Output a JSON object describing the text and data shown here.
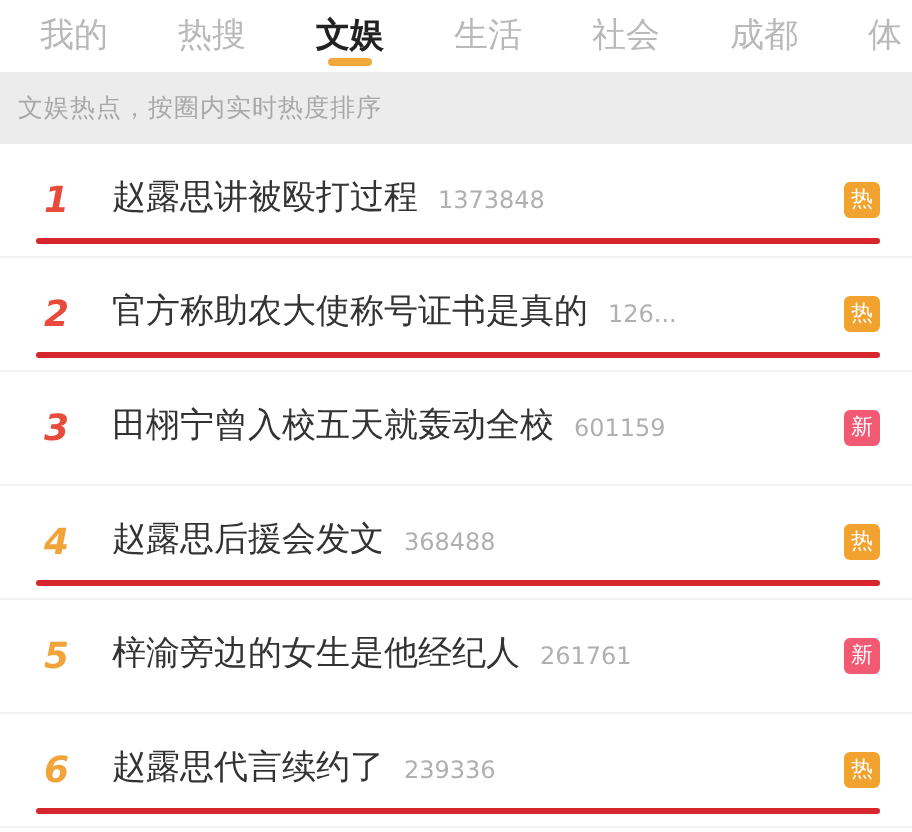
{
  "tabs": [
    {
      "label": "我的",
      "selected": false
    },
    {
      "label": "热搜",
      "selected": false
    },
    {
      "label": "文娱",
      "selected": true
    },
    {
      "label": "生活",
      "selected": false
    },
    {
      "label": "社会",
      "selected": false
    },
    {
      "label": "成都",
      "selected": false
    },
    {
      "label": "体",
      "selected": false
    }
  ],
  "notice": "文娱热点，按圈内实时热度排序",
  "items": [
    {
      "rank": "1",
      "title": "赵露思讲被殴打过程",
      "count": "1373848",
      "badge": "热",
      "kind": "hot",
      "color": "#e84b3c",
      "underlined": true
    },
    {
      "rank": "2",
      "title": "官方称助农大使称号证书是真的",
      "count": "126...",
      "badge": "热",
      "kind": "hot",
      "color": "#e84b3c",
      "underlined": true
    },
    {
      "rank": "3",
      "title": "田栩宁曾入校五天就轰动全校",
      "count": "601159",
      "badge": "新",
      "kind": "new",
      "color": "#e84b3c",
      "underlined": false
    },
    {
      "rank": "4",
      "title": "赵露思后援会发文",
      "count": "368488",
      "badge": "热",
      "kind": "hot",
      "color": "#f0a43a",
      "underlined": true
    },
    {
      "rank": "5",
      "title": "梓渝旁边的女生是他经纪人",
      "count": "261761",
      "badge": "新",
      "kind": "new",
      "color": "#f0a43a",
      "underlined": false
    },
    {
      "rank": "6",
      "title": "赵露思代言续约了",
      "count": "239336",
      "badge": "热",
      "kind": "hot",
      "color": "#f0a43a",
      "underlined": true
    }
  ]
}
